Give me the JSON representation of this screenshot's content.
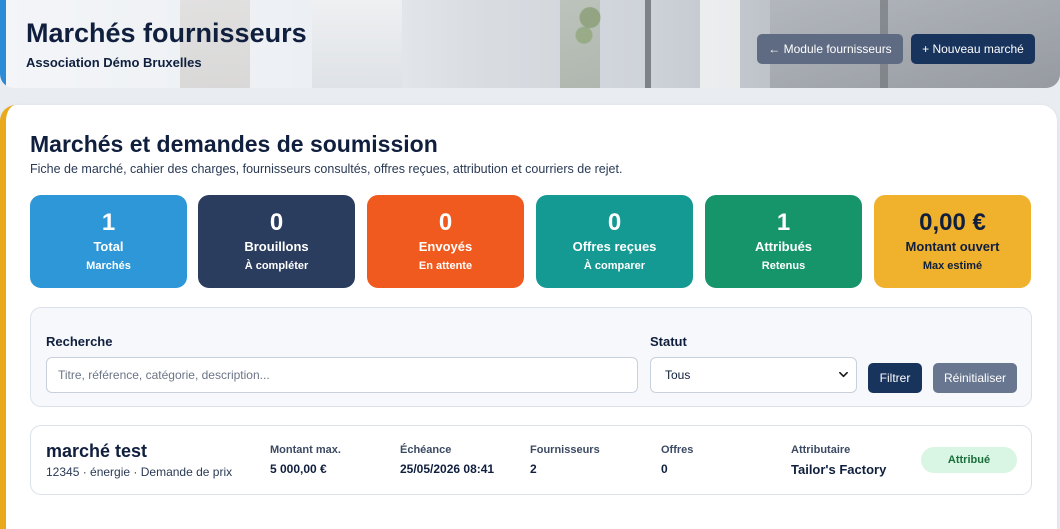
{
  "header": {
    "title": "Marchés fournisseurs",
    "subtitle": "Association Démo Bruxelles",
    "module_button": "← Module fournisseurs",
    "new_button": "+ Nouveau marché"
  },
  "main": {
    "title": "Marchés et demandes de soumission",
    "description": "Fiche de marché, cahier des charges, fournisseurs consultés, offres reçues, attribution et courriers de rejet."
  },
  "stats": [
    {
      "value": "1",
      "label": "Total",
      "sub": "Marchés",
      "color": "#2e97d8"
    },
    {
      "value": "0",
      "label": "Brouillons",
      "sub": "À compléter",
      "color": "#2b3d5e"
    },
    {
      "value": "0",
      "label": "Envoyés",
      "sub": "En attente",
      "color": "#f05a1e"
    },
    {
      "value": "0",
      "label": "Offres reçues",
      "sub": "À comparer",
      "color": "#149a93"
    },
    {
      "value": "1",
      "label": "Attribués",
      "sub": "Retenus",
      "color": "#17956a"
    },
    {
      "value": "0,00 €",
      "label": "Montant ouvert",
      "sub": "Max estimé",
      "color": "#f0b12c"
    }
  ],
  "filters": {
    "search_label": "Recherche",
    "search_placeholder": "Titre, référence, catégorie, description...",
    "search_value": "",
    "status_label": "Statut",
    "status_value": "Tous",
    "apply_button": "Filtrer",
    "reset_button": "Réinitialiser"
  },
  "markets": [
    {
      "name": "marché test",
      "meta": "12345 · énergie · Demande de prix",
      "columns": [
        {
          "header": "Montant max.",
          "value": "5 000,00 €"
        },
        {
          "header": "Échéance",
          "value": "25/05/2026 08:41"
        },
        {
          "header": "Fournisseurs",
          "value": "2"
        },
        {
          "header": "Offres",
          "value": "0"
        },
        {
          "header": "Attributaire",
          "value": "Tailor's Factory"
        }
      ],
      "status": "Attribué",
      "status_color": "#1a6e3c"
    }
  ],
  "icons": {
    "status_dropdown": "chevron-down-icon"
  }
}
